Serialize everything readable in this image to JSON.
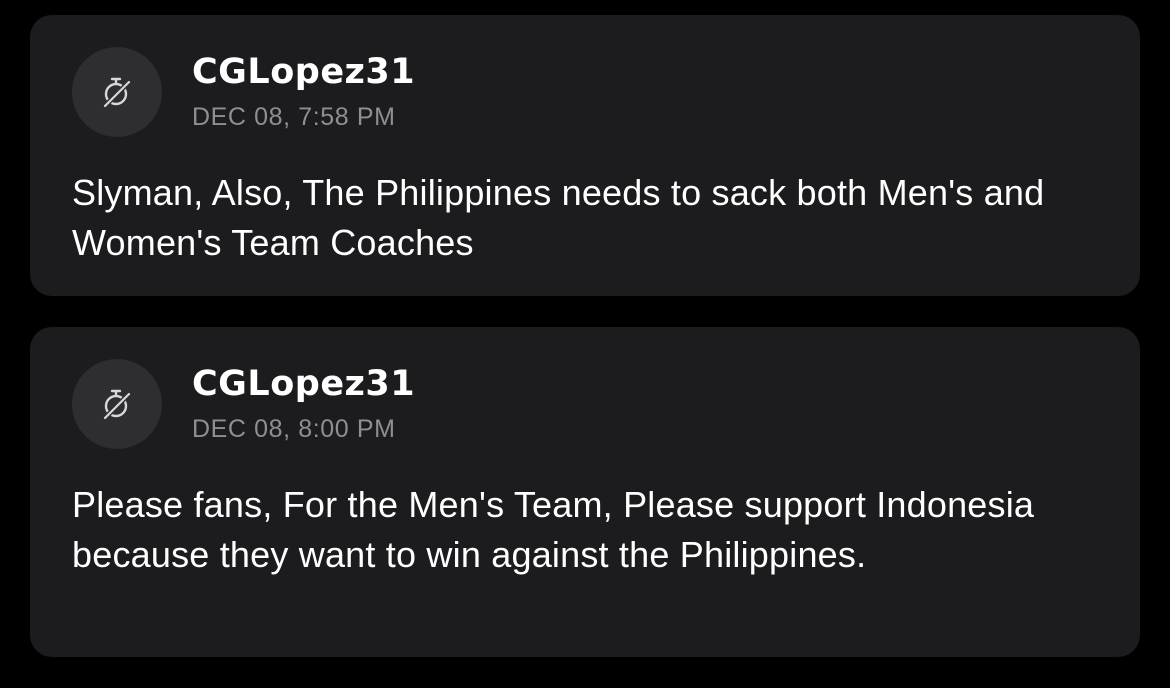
{
  "comments": [
    {
      "username": "CGLopez31",
      "timestamp": "DEC 08, 7:58 PM",
      "avatar_icon": "stopwatch-slash-icon",
      "text": "Slyman, Also, The Philippines needs to sack both Men's and Women's Team Coaches"
    },
    {
      "username": "CGLopez31",
      "timestamp": "DEC 08, 8:00 PM",
      "avatar_icon": "stopwatch-slash-icon",
      "text": "Please fans, For the Men's Team, Please support Indonesia because they want to win against the Philippines."
    }
  ],
  "colors": {
    "background": "#000000",
    "card": "#1c1c1e",
    "avatar": "#2e2e30",
    "username": "#ffffff",
    "timestamp": "#8e8e93",
    "text": "#ffffff"
  }
}
